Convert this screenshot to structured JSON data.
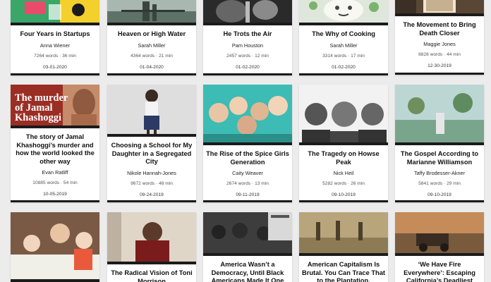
{
  "cards": [
    {
      "title": "Four Years in Startups",
      "author": "Anna Wiener",
      "words": "7264 words · 36 min",
      "date": "03-01-2020",
      "thumb_icon": "photo-icon"
    },
    {
      "title": "Heaven or High Water",
      "author": "Sarah Miller",
      "words": "4364 words · 21 min",
      "date": "01-04-2020",
      "thumb_icon": "photo-icon"
    },
    {
      "title": "He Trots the Air",
      "author": "Pam Houston",
      "words": "2457 words · 12 min",
      "date": "01-02-2020",
      "thumb_icon": "photo-icon"
    },
    {
      "title": "The Why of Cooking",
      "author": "Sarah Miller",
      "words": "3314 words · 17 min",
      "date": "01-02-2020",
      "thumb_icon": "photo-icon"
    },
    {
      "title": "The Movement to Bring Death Closer",
      "author": "Maggie Jones",
      "words": "8828 words · 44 min",
      "date": "12-30-2019",
      "thumb_icon": "photo-icon"
    },
    {
      "title": "The story of Jamal Khashoggi’s murder and how the world looked the other way",
      "author": "Evan Ratliff",
      "words": "10885 words · 54 min",
      "date": "10-05-2019",
      "thumb_icon": "photo-icon",
      "thumb_text": "The murder of Jamal Khashoggi"
    },
    {
      "title": "Choosing a School for My Daughter in a Segregated City",
      "author": "Nikole Hannah-Jones",
      "words": "9672 words · 48 min",
      "date": "09-24-2019",
      "thumb_icon": "photo-icon"
    },
    {
      "title": "The Rise of the Spice Girls Generation",
      "author": "Caity Weaver",
      "words": "2674 words · 13 min",
      "date": "09-11-2019",
      "thumb_icon": "photo-icon"
    },
    {
      "title": "The Tragedy on Howse Peak",
      "author": "Nick Heil",
      "words": "5282 words · 26 min",
      "date": "09-10-2019",
      "thumb_icon": "photo-icon"
    },
    {
      "title": "The Gospel According to Marianne Williamson",
      "author": "Taffy Brodesser-Akner",
      "words": "5841 words · 29 min",
      "date": "09-10-2019",
      "thumb_icon": "photo-icon"
    },
    {
      "title": "",
      "author": "",
      "words": "",
      "date": "",
      "thumb_icon": "photo-icon"
    },
    {
      "title": "The Radical Vision of Toni Morrison",
      "author": "",
      "words": "",
      "date": "",
      "thumb_icon": "photo-icon"
    },
    {
      "title": "America Wasn’t a Democracy, Until Black Americans Made It One",
      "author": "",
      "words": "",
      "date": "",
      "thumb_icon": "photo-icon"
    },
    {
      "title": "American Capitalism Is Brutal. You Can Trace That to the Plantation.",
      "author": "",
      "words": "",
      "date": "",
      "thumb_icon": "photo-icon"
    },
    {
      "title": "‘We Have Fire Everywhere’: Escaping California’s Deadliest Blaze",
      "author": "",
      "words": "",
      "date": "",
      "thumb_icon": "photo-icon"
    }
  ]
}
